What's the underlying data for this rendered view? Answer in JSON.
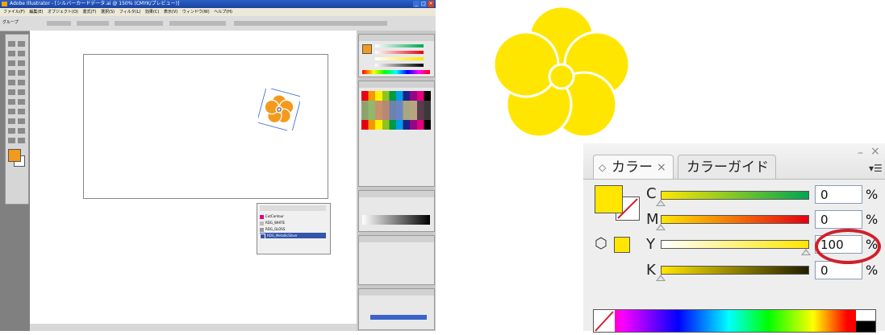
{
  "illustrator": {
    "title": "Adobe Illustrator - [シルバーカードデータ.ai @ 150% (CMYK/プレビュー)]",
    "menu": [
      "ファイル(F)",
      "編集(E)",
      "オブジェクト(O)",
      "書式(T)",
      "選択(S)",
      "フィルタ(L)",
      "効果(C)",
      "表示(V)",
      "ウィンドウ(W)",
      "ヘルプ(H)"
    ],
    "control_label": "グループ",
    "links_panel": {
      "items": [
        {
          "name": "CutContour",
          "color": "#e4007f"
        },
        {
          "name": "RDG_WHITE",
          "color": "#bbbbbb"
        },
        {
          "name": "RDG_GLOSS",
          "color": "#999999"
        },
        {
          "name": "RDG_MetallicSilver",
          "color": "#3355aa"
        }
      ]
    },
    "colors": {
      "flower": "#f39a1d",
      "ui_panel": "#e8e8e8"
    }
  },
  "flower": {
    "color": "#ffe600",
    "outline": "#ffffff"
  },
  "color_panel": {
    "tabs": [
      {
        "label": "カラー",
        "active": true
      },
      {
        "label": "カラーガイド",
        "active": false
      }
    ],
    "fill_color": "#ffe600",
    "sliders": [
      {
        "label": "C",
        "value": "0",
        "level": 0,
        "gradient_end": "#00a651"
      },
      {
        "label": "M",
        "value": "0",
        "level": 0,
        "gradient_end": "#e60012"
      },
      {
        "label": "Y",
        "value": "100",
        "level": 100,
        "gradient_end": "#ffe600"
      },
      {
        "label": "K",
        "value": "0",
        "level": 0,
        "gradient_end": "#221e00"
      }
    ],
    "unit": "%",
    "highlight_color": "#d0202a"
  }
}
